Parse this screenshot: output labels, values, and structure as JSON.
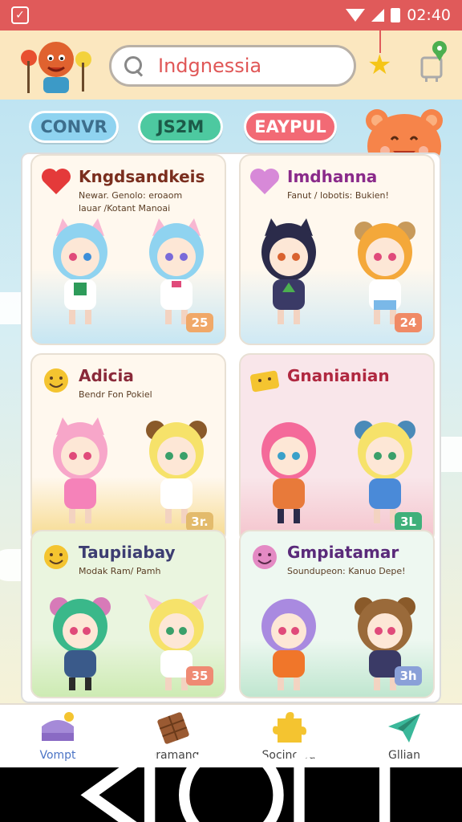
{
  "status_bar": {
    "time": "02:40"
  },
  "search": {
    "value": "Indgnessia"
  },
  "chips": [
    "CONVR",
    "JS2M",
    "EAYPUL"
  ],
  "cards": [
    {
      "title": "Kngdsandkeis",
      "subtitle": "Newar. Genolo: eroaom\nlauar /Kotant Manoai",
      "badge": "25",
      "title_color": "#7a2e1e",
      "bg_top": "#fff8ee",
      "bg_bottom": "#c6e6f3",
      "badge_color": "#f0a868"
    },
    {
      "title": "Imdhanna",
      "subtitle": "Fanut / lobotis: Bukien!",
      "badge": "24",
      "title_color": "#8a2a8a",
      "bg_top": "#fff8ee",
      "bg_bottom": "#cfe9f4",
      "badge_color": "#f08a66"
    },
    {
      "title": "Adicia",
      "subtitle": "Bendr Fon Pokiel",
      "badge": "3r.",
      "title_color": "#8a2a3a",
      "bg_top": "#fff8ee",
      "bg_bottom": "#f6d98a",
      "badge_color": "#e3bb6c"
    },
    {
      "title": "Gnanianian",
      "subtitle": "",
      "badge": "3L",
      "title_color": "#b02840",
      "bg_top": "#f9e6ea",
      "bg_bottom": "#f4c2cb",
      "badge_color": "#3fb07a"
    },
    {
      "title": "Taupiiabay",
      "subtitle": "Modak Ram/ Pamh",
      "badge": "35",
      "title_color": "#3d3d72",
      "bg_top": "#eaf5df",
      "bg_bottom": "#cdebb3",
      "badge_color": "#ef8a73"
    },
    {
      "title": "Gmpiatamar",
      "subtitle": "Soundupeon: Kanuo Depe!",
      "badge": "3h",
      "title_color": "#5a2a7a",
      "bg_top": "#eef8f1",
      "bg_bottom": "#bfe6cf",
      "badge_color": "#8aa0d8"
    }
  ],
  "nav": [
    {
      "label": "Vompt",
      "icon": "cake-icon",
      "active": true
    },
    {
      "label": "Dramang",
      "icon": "chocolate-icon",
      "active": false
    },
    {
      "label": "Socinclod",
      "icon": "puzzle-icon",
      "active": false
    },
    {
      "label": "Gllian",
      "icon": "paper-plane-icon",
      "active": false
    }
  ],
  "colors": {
    "status_bar": "#e05a5a",
    "header_bg": "#fbe7bf",
    "accent_blue": "#4b74c5"
  }
}
